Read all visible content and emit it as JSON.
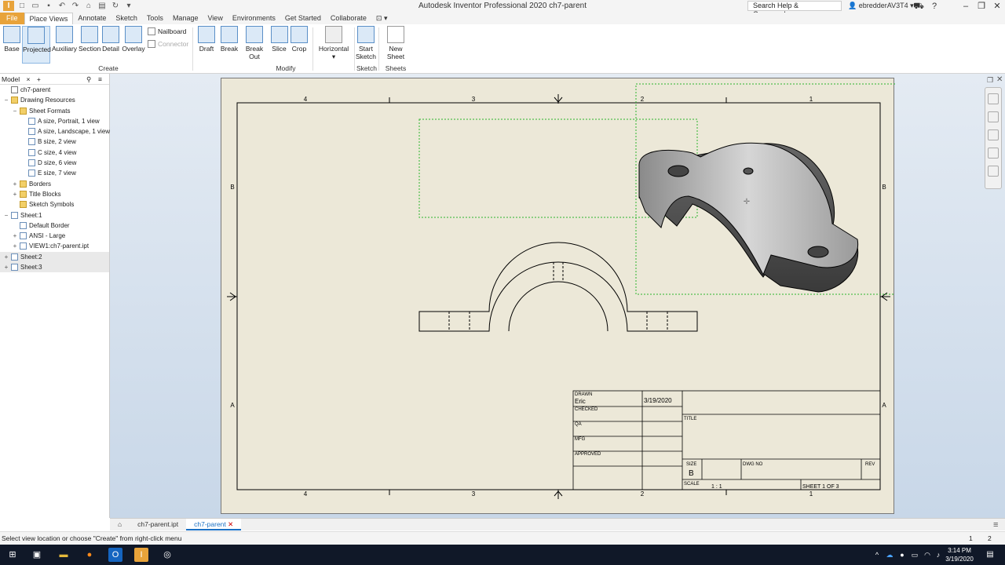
{
  "app": {
    "title": "Autodesk Inventor Professional 2020   ch7-parent",
    "search_placeholder": "Search Help & Commands...",
    "user": "ebredderAV3T4",
    "logo_letter": "I"
  },
  "ribbon_tabs": [
    "File",
    "Place Views",
    "Annotate",
    "Sketch",
    "Tools",
    "Manage",
    "View",
    "Environments",
    "Get Started",
    "Collaborate"
  ],
  "ribbon": {
    "create_buttons": [
      "Base",
      "Projected",
      "Auxiliary",
      "Section",
      "Detail",
      "Overlay"
    ],
    "nailboard": "Nailboard",
    "connector": "Connector",
    "modify_buttons": [
      "Draft",
      "Break",
      "Break Out",
      "Slice",
      "Crop"
    ],
    "horizontal": "Horizontal",
    "start_sketch": "Start Sketch",
    "start_sketch_l1": "Start",
    "start_sketch_l2": "Sketch",
    "new_sheet": "New Sheet",
    "groups": [
      "Create",
      "Modify",
      "Sketch",
      "Sheets"
    ]
  },
  "browser": {
    "tab": "Model",
    "close": "×",
    "add": "+",
    "tree": [
      {
        "label": "ch7-parent",
        "depth": 0,
        "exp": "",
        "icon": "doc"
      },
      {
        "label": "Drawing Resources",
        "depth": 0,
        "exp": "−",
        "icon": "folder"
      },
      {
        "label": "Sheet Formats",
        "depth": 1,
        "exp": "−",
        "icon": "folder"
      },
      {
        "label": "A size, Portrait, 1 view",
        "depth": 2,
        "exp": "",
        "icon": "sheet"
      },
      {
        "label": "A size, Landscape, 1 view",
        "depth": 2,
        "exp": "",
        "icon": "sheet"
      },
      {
        "label": "B size, 2 view",
        "depth": 2,
        "exp": "",
        "icon": "sheet"
      },
      {
        "label": "C size, 4 view",
        "depth": 2,
        "exp": "",
        "icon": "sheet"
      },
      {
        "label": "D size, 6 view",
        "depth": 2,
        "exp": "",
        "icon": "sheet"
      },
      {
        "label": "E size, 7 view",
        "depth": 2,
        "exp": "",
        "icon": "sheet"
      },
      {
        "label": "Borders",
        "depth": 1,
        "exp": "+",
        "icon": "folder"
      },
      {
        "label": "Title Blocks",
        "depth": 1,
        "exp": "+",
        "icon": "folder"
      },
      {
        "label": "Sketch Symbols",
        "depth": 1,
        "exp": "",
        "icon": "folder"
      },
      {
        "label": "Sheet:1",
        "depth": 0,
        "exp": "−",
        "icon": "sheet"
      },
      {
        "label": "Default Border",
        "depth": 1,
        "exp": "",
        "icon": "sheet"
      },
      {
        "label": "ANSI - Large",
        "depth": 1,
        "exp": "+",
        "icon": "sheet"
      },
      {
        "label": "VIEW1:ch7-parent.ipt",
        "depth": 1,
        "exp": "+",
        "icon": "sheet"
      },
      {
        "label": "Sheet:2",
        "depth": 0,
        "exp": "+",
        "icon": "sheet",
        "hl": true
      },
      {
        "label": "Sheet:3",
        "depth": 0,
        "exp": "+",
        "icon": "sheet",
        "hl": true
      }
    ]
  },
  "drawing": {
    "zone_cols": [
      "4",
      "3",
      "2",
      "1"
    ],
    "zone_rows": [
      "B",
      "A"
    ],
    "title_block": {
      "drawn": "DRAWN",
      "drawn_by": "Eric",
      "date": "3/19/2020",
      "checked": "CHECKED",
      "qa": "QA",
      "mfg": "MFG",
      "approved": "APPROVED",
      "title": "TITLE",
      "size": "SIZE",
      "size_value": "B",
      "dwg_no": "DWG NO",
      "rev": "REV",
      "scale": "SCALE",
      "scale_value": "1 : 1",
      "sheet": "SHEET 1  OF 3"
    }
  },
  "doc_tabs": [
    "ch7-parent.ipt",
    "ch7-parent"
  ],
  "status": {
    "message": "Select view location or choose \"Create\" from right-click menu",
    "num1": "1",
    "num2": "2"
  },
  "taskbar": {
    "time": "3:14 PM",
    "date": "3/19/2020"
  }
}
